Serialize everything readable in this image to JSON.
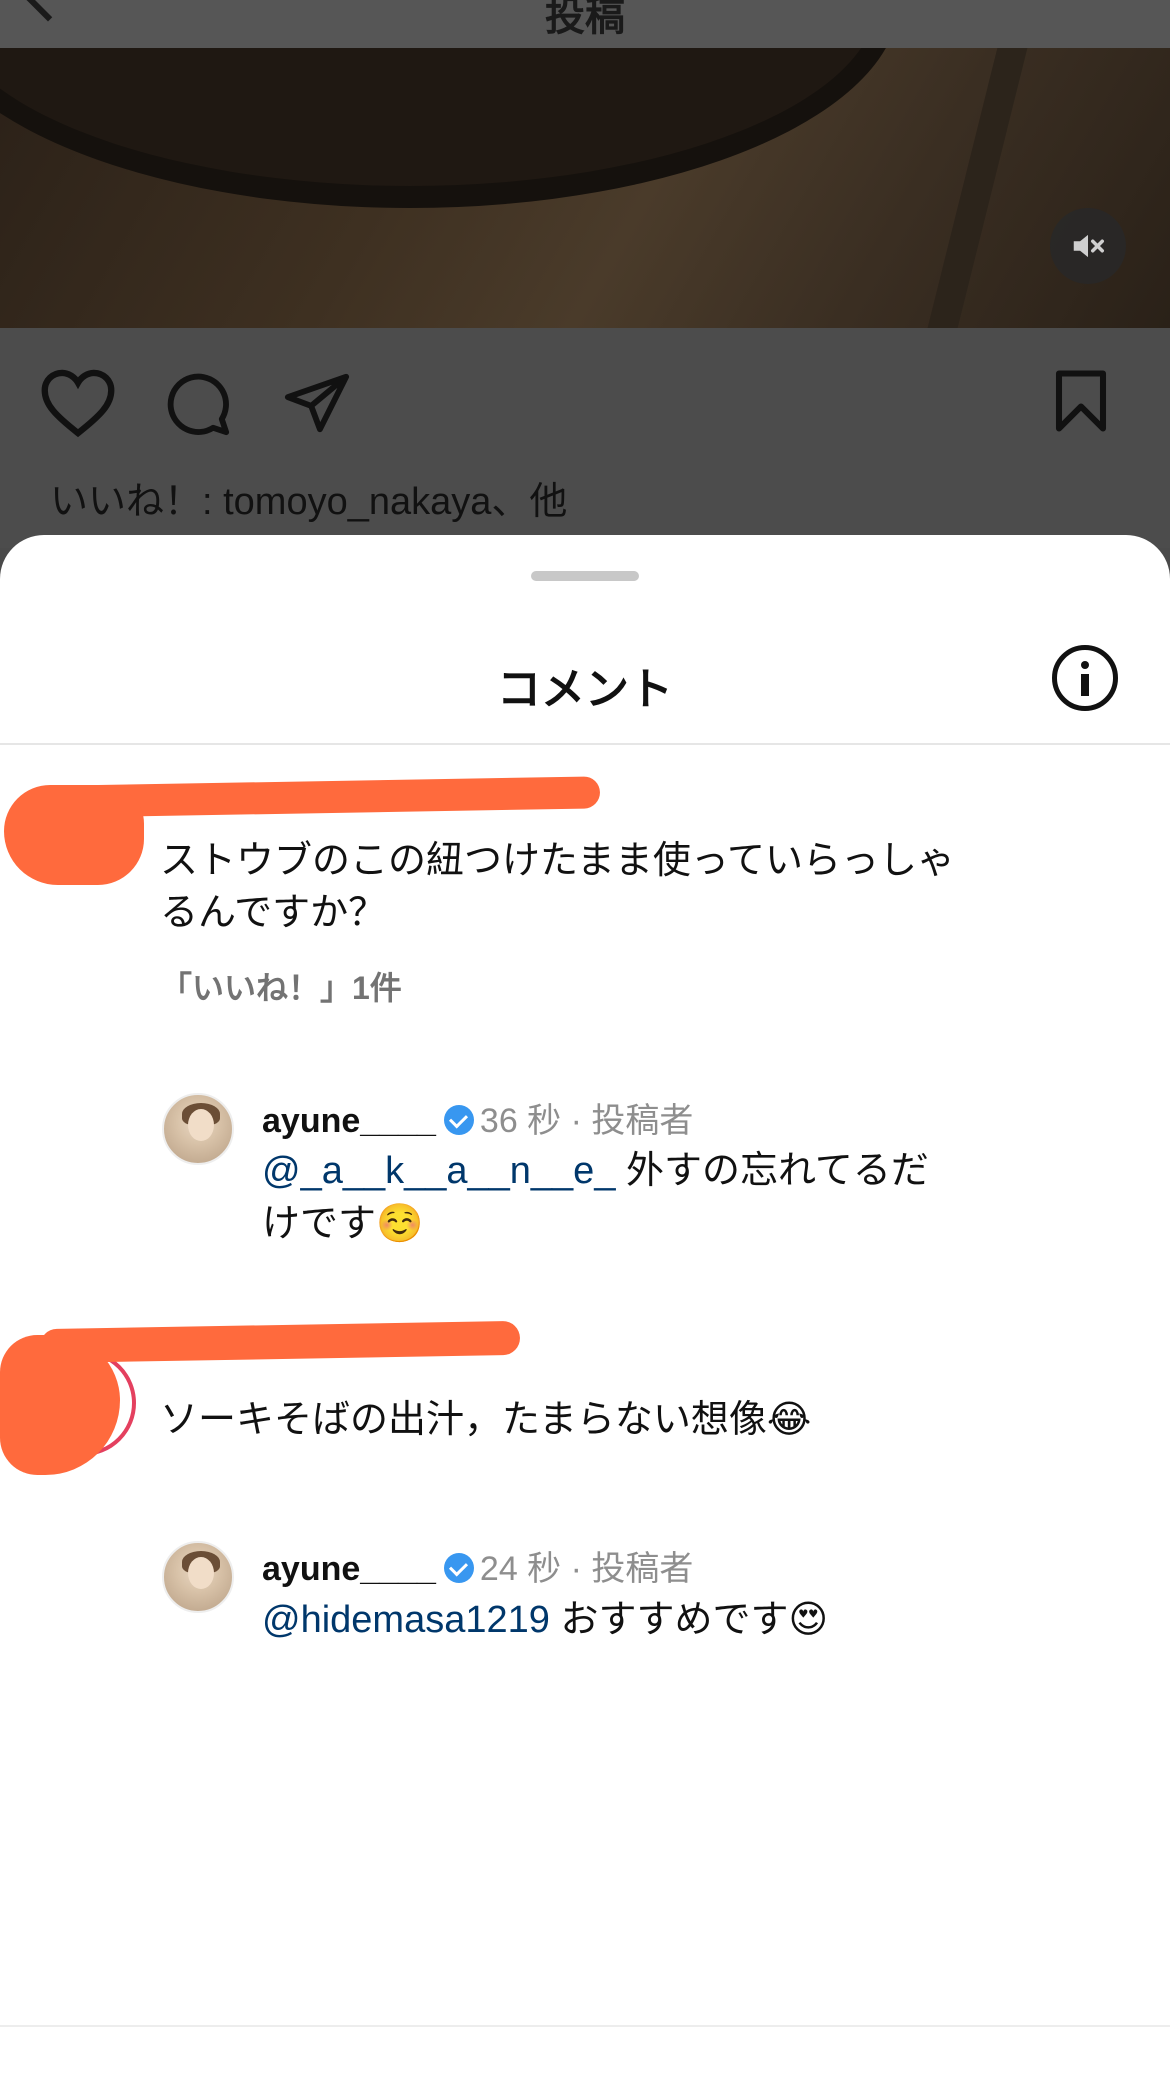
{
  "topbar": {
    "title": "投稿"
  },
  "post": {
    "likes_text": "いいね！: tomoyo_nakaya、他"
  },
  "sheet": {
    "title": "コメント"
  },
  "comments": [
    {
      "text_line1": "ストウブのこの紐つけたまま使っていらっしゃ",
      "text_line2": "るんですか？",
      "likes": "「いいね！」1件",
      "reply": {
        "username": "ayune____",
        "time": "36 秒",
        "role": "投稿者",
        "mention": "@_a__k__a__n__e_",
        "text_line1": " 外すの忘れてるだ",
        "text_line2": "けです",
        "emoji": "☺️"
      }
    },
    {
      "text": "ソーキそばの出汁，たまらない想像",
      "emoji": "😂",
      "reply": {
        "username": "ayune____",
        "time": "24 秒",
        "role": "投稿者",
        "mention": "@hidemasa1219",
        "text": " おすすめです",
        "emoji": "😍"
      }
    }
  ],
  "colors": {
    "mention": "#00376b",
    "verified": "#3897f0",
    "redaction": "#ff6a3d"
  }
}
